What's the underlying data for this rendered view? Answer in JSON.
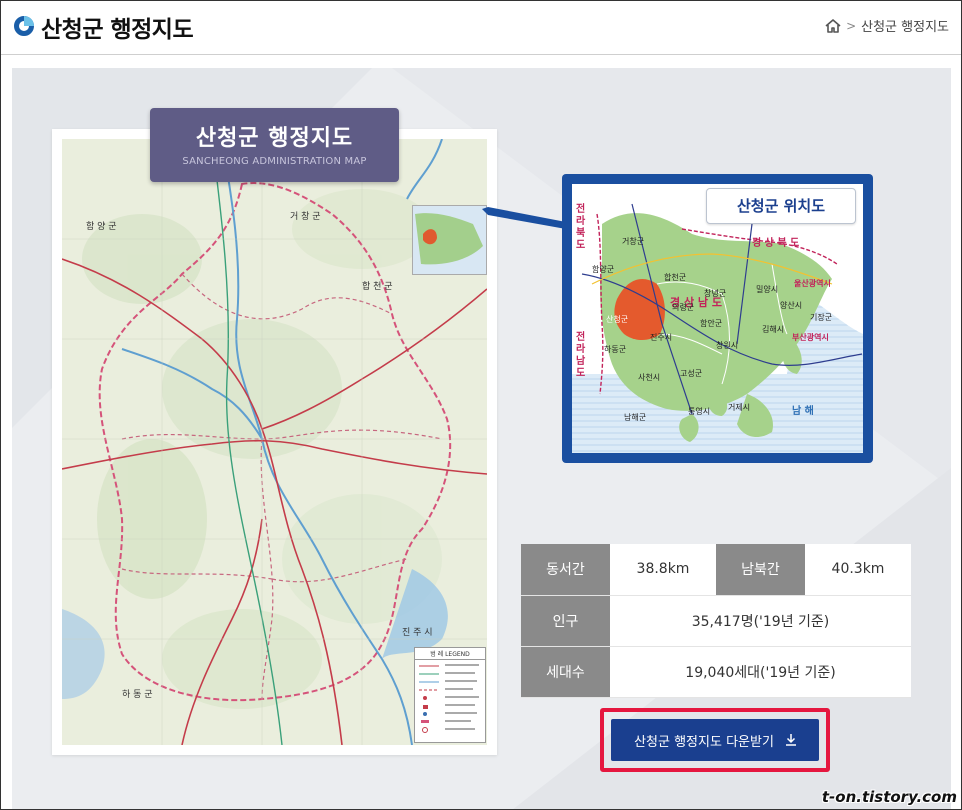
{
  "header": {
    "title": "산청군 행정지도",
    "breadcrumb": {
      "home_icon": "home-icon",
      "separator": ">",
      "current": "산청군 행정지도"
    }
  },
  "map": {
    "banner_title": "산청군 행정지도",
    "banner_subtitle": "SANCHEONG ADMINISTRATION MAP",
    "legend_title": "범 례   LEGEND",
    "place_labels": [
      "거 창 군",
      "합 천 군",
      "함 양 군",
      "하 동 군",
      "진 주 시"
    ]
  },
  "inset": {
    "label": "산청군 위치도",
    "provinces": [
      "전라북도",
      "전라남도",
      "경 상 북 도",
      "경 상 남 도"
    ],
    "places": [
      "거창군",
      "함양군",
      "합천군",
      "산청군",
      "의령군",
      "하동군",
      "진주시",
      "함안군",
      "창녕군",
      "밀양시",
      "양산시",
      "김해시",
      "사천시",
      "고성군",
      "창원시",
      "통영시",
      "거제시",
      "남해군",
      "울산광역시",
      "부산광역시",
      "기장군"
    ],
    "sea": "남 해"
  },
  "info": {
    "rows": [
      {
        "h1": "동서간",
        "v1": "38.8km",
        "h2": "남북간",
        "v2": "40.3km"
      },
      {
        "h1": "인구",
        "v1": "35,417명('19년 기준)"
      },
      {
        "h1": "세대수",
        "v1": "19,040세대('19년 기준)"
      }
    ]
  },
  "download": {
    "label": "산청군 행정지도 다운받기",
    "icon": "download-icon"
  },
  "watermark": "t-on.tistory.com",
  "colors": {
    "accent": "#1a3f8f",
    "highlight": "#e5173f",
    "banner": "#5f5c86",
    "inset_frame": "#1a4fa0"
  }
}
